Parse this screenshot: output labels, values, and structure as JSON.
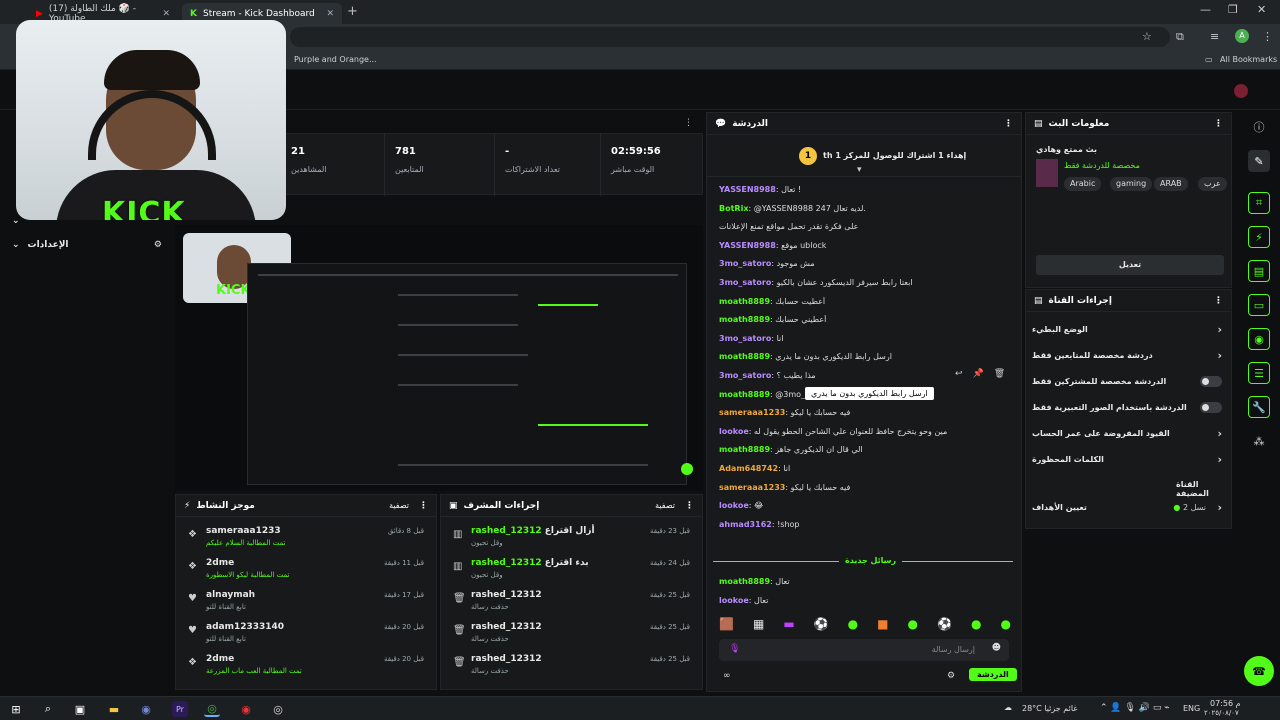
{
  "browser": {
    "tabs": [
      {
        "label": "(17) ملك الطاولة 🎲 - YouTube"
      },
      {
        "label": "Stream - Kick Dashboard"
      }
    ],
    "bookmark": "Purple and Orange...",
    "all_bookmarks": "All Bookmarks",
    "profile_initial": "A"
  },
  "webcam": {
    "logo": "KICK"
  },
  "leftnav": {
    "settings": "الإعدادات"
  },
  "stats": [
    {
      "value": "21",
      "label": "المشاهدين"
    },
    {
      "value": "781",
      "label": "المتابعين"
    },
    {
      "value": "-",
      "label": "تعداد الاشتراكات"
    },
    {
      "value": "02:59:56",
      "label": "الوقت مباشر"
    }
  ],
  "activity": {
    "title": "موجز النشاط",
    "filter": "تصفية",
    "rows": [
      {
        "name": "sameraaa1233",
        "sub": "تمت المطالبة السلام عليكم",
        "time": "قبل 8 دقائق",
        "green": true
      },
      {
        "name": "2dme",
        "sub": "تمت المطالبة ليكو الاسطورة",
        "time": "قبل 11 دقيقة",
        "green": true
      },
      {
        "name": "alnaymah",
        "sub": "تابع القناة للتو",
        "time": "قبل 17 دقيقة",
        "green": false
      },
      {
        "name": "adam12333140",
        "sub": "تابع القناة للتو",
        "time": "قبل 20 دقيقة",
        "green": false
      },
      {
        "name": "2dme",
        "sub": "تمت المطالبة العب ماب المزرعة",
        "time": "قبل 20 دقيقة",
        "green": true
      }
    ]
  },
  "moderation": {
    "title": "إجراءات المشرف",
    "filter": "تصفية",
    "rows": [
      {
        "name": "rashed_12312",
        "action": "أزال اقتراع",
        "sub": "وقل تحيون",
        "time": "قبل 23 دقيقة"
      },
      {
        "name": "rashed_12312",
        "action": "بدء اقتراع",
        "sub": "وقل تحيون",
        "time": "قبل 24 دقيقة"
      },
      {
        "name": "rashed_12312",
        "action": "",
        "sub": "حذفت رسالة",
        "time": "قبل 25 دقيقة"
      },
      {
        "name": "rashed_12312",
        "action": "",
        "sub": "حذفت رسالة",
        "time": "قبل 25 دقيقة"
      },
      {
        "name": "rashed_12312",
        "action": "",
        "sub": "حذفت رسالة",
        "time": "قبل 25 دقيقة"
      }
    ]
  },
  "chat": {
    "title": "الدردشة",
    "pinned": "th إهداء 1 اشتراك للوصول للمركز 1",
    "pinned_rank": "1",
    "messages": [
      {
        "user": "YASSEN8988",
        "color": "#b88cff",
        "text": "تعال !"
      },
      {
        "user": "BotRix",
        "color": "#53fc18",
        "text": "@YASSEN8988 247 لديه تعال."
      },
      {
        "user": "",
        "color": "#ddd",
        "text": "على فكرة تقدر تحمل مواقع تمنع الإعلانات"
      },
      {
        "user": "YASSEN8988",
        "color": "#b88cff",
        "text": "موقع ublock"
      },
      {
        "user": "3mo_satoro",
        "color": "#b88cff",
        "text": "مش موجود"
      },
      {
        "user": "3mo_satoro",
        "color": "#b88cff",
        "text": "ابعتا رابط سيرفر الديسكورد عشان بالكيو"
      },
      {
        "user": "moath8889",
        "color": "#53fc18",
        "text": "أعطيت حسابك"
      },
      {
        "user": "moath8889",
        "color": "#53fc18",
        "text": "أعطيني حسابك"
      },
      {
        "user": "3mo_satoro",
        "color": "#b88cff",
        "text": "انا"
      },
      {
        "user": "moath8889",
        "color": "#53fc18",
        "text": "ارسل رابط الديكوري بدون ما يدري"
      },
      {
        "user": "3mo_satoro",
        "color": "#b88cff",
        "text": "مذا يطيب ؟"
      },
      {
        "user": "moath8889",
        "color": "#53fc18",
        "text": "@3mo_satoro اكلم راشد مو انت"
      },
      {
        "user": "sameraaa1233",
        "color": "#f0a83a",
        "text": "فيه حسابك يا ليكو"
      },
      {
        "user": "lookoe",
        "color": "#b88cff",
        "text": "مين وحو يتخرج حافظ للعنوان علي الشاحن الحطو يقول له"
      },
      {
        "user": "moath8889",
        "color": "#53fc18",
        "text": "الي قال ان الديكوري جاهز"
      },
      {
        "user": "Adam648742",
        "color": "#f0a83a",
        "text": "انا"
      },
      {
        "user": "sameraaa1233",
        "color": "#f0a83a",
        "text": "فيه حسابك يا ليكو"
      },
      {
        "user": "lookoe",
        "color": "#b88cff",
        "text": "😂"
      },
      {
        "user": "ahmad3162",
        "color": "#b88cff",
        "text": "!shop"
      }
    ],
    "new_messages": "رسائل جديدة",
    "after": [
      {
        "user": "moath8889",
        "color": "#53fc18",
        "text": "تعال"
      },
      {
        "user": "lookoe",
        "color": "#b88cff",
        "text": "تعال"
      }
    ],
    "tooltip": "ارسل رابط الديكوري بدون ما يدري",
    "input_placeholder": "إرسال رسالة",
    "send": "الدردشة"
  },
  "stream_info": {
    "title": "معلومات البث",
    "stream_title": "بث ممتع وهادي",
    "category": "مخصصة للدردشة فقط",
    "tags": [
      "عرب",
      "ARAB",
      "gaming",
      "Arabic"
    ],
    "edit": "تعديل"
  },
  "channel_actions": {
    "title": "إجراءات القناة",
    "items": [
      {
        "label": "الوضع البطيء",
        "type": "chev"
      },
      {
        "label": "دردشة مخصصة للمتابعين فقط",
        "type": "chev"
      },
      {
        "label": "الدردشة مخصصة للمشتركين فقط",
        "type": "toggle"
      },
      {
        "label": "الدردشة باستخدام الصور التعبيرية فقط",
        "type": "toggle"
      },
      {
        "label": "القيود المفروضة على عمر الحساب",
        "type": "chev"
      },
      {
        "label": "الكلمات المحظورة",
        "type": "chev"
      }
    ],
    "section": "القناة المضيفة",
    "goal": "تعيين الأهداف",
    "goal_value": "نسل 2"
  },
  "taskbar": {
    "weather": "28°C غائم جزئيا",
    "lang": "ENG",
    "time": "07:56 م",
    "date": "٢٠٢٥/٠٨/٠٧"
  }
}
